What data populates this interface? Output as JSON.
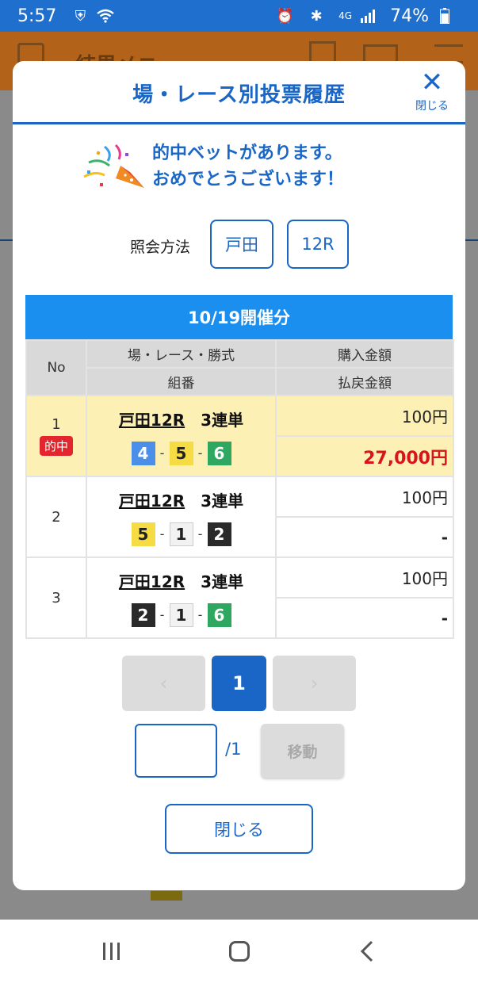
{
  "status_bar": {
    "time": "5:57",
    "network": "4G",
    "battery": "74%"
  },
  "background": {
    "title": "結果メニュー"
  },
  "modal": {
    "title": "場・レース別投票履歴",
    "close_label": "閉じる",
    "congrats_line1": "的中ベットがあります。",
    "congrats_line2": "おめでとうございます！",
    "query_label": "照会方法",
    "query_place": "戸田",
    "query_race": "12R",
    "session": "10/19開催分",
    "headers": {
      "no": "No",
      "race_type": "場・レース・勝式",
      "combo": "組番",
      "purchase": "購入金額",
      "payout": "払戻金額"
    },
    "rows": [
      {
        "no": "1",
        "badge": "的中",
        "place": "戸田12R",
        "bet_type": "3連単",
        "combo": [
          "4",
          "5",
          "6"
        ],
        "purchase": "100円",
        "payout": "27,000円"
      },
      {
        "no": "2",
        "place": "戸田12R",
        "bet_type": "3連単",
        "combo": [
          "5",
          "1",
          "2"
        ],
        "purchase": "100円",
        "payout": "-"
      },
      {
        "no": "3",
        "place": "戸田12R",
        "bet_type": "3連単",
        "combo": [
          "2",
          "1",
          "6"
        ],
        "purchase": "100円",
        "payout": "-"
      }
    ],
    "pager": {
      "prev": "‹",
      "current": "1",
      "next": "›",
      "total": "/1",
      "move": "移動",
      "input_value": ""
    },
    "close_button": "閉じる"
  },
  "colors": {
    "primary": "#1a66c6",
    "session_bar": "#1a8ff0",
    "win_row": "#fdf0b4",
    "hit_red": "#d8141c"
  }
}
